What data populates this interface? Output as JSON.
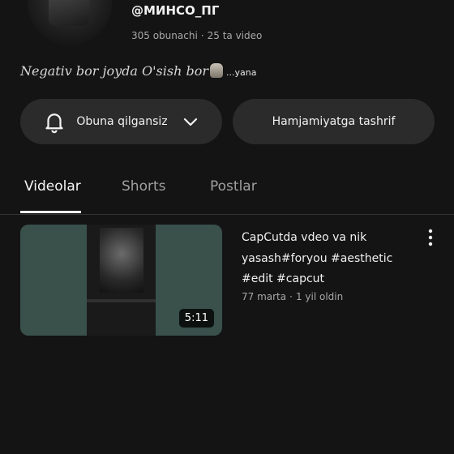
{
  "channel": {
    "handle": "@МИНСО_ПГ",
    "subscribers": "305 obunachi",
    "videos": "25 ta video",
    "separator": "·",
    "bio": "Negativ bor joyda O'sish bor",
    "bio_more": "...yana"
  },
  "actions": {
    "subscribe_label": "Obuna qilgansiz",
    "community_label": "Hamjamiyatga tashrif"
  },
  "tabs": [
    {
      "label": "Videolar",
      "active": true
    },
    {
      "label": "Shorts",
      "active": false
    },
    {
      "label": "Postlar",
      "active": false
    }
  ],
  "videos": [
    {
      "title": "CapCutda vdeo va nik yasash#foryou #aesthetic #edit #capcut",
      "views": "77 marta",
      "age": "1 yil oldin",
      "duration": "5:11"
    }
  ],
  "colors": {
    "background": "#141414",
    "button": "#2b2b2b",
    "text": "#f1f1f1",
    "muted": "#a8a8a8"
  },
  "icons": [
    "bell-icon",
    "chevron-down-icon",
    "more-vert-icon"
  ]
}
